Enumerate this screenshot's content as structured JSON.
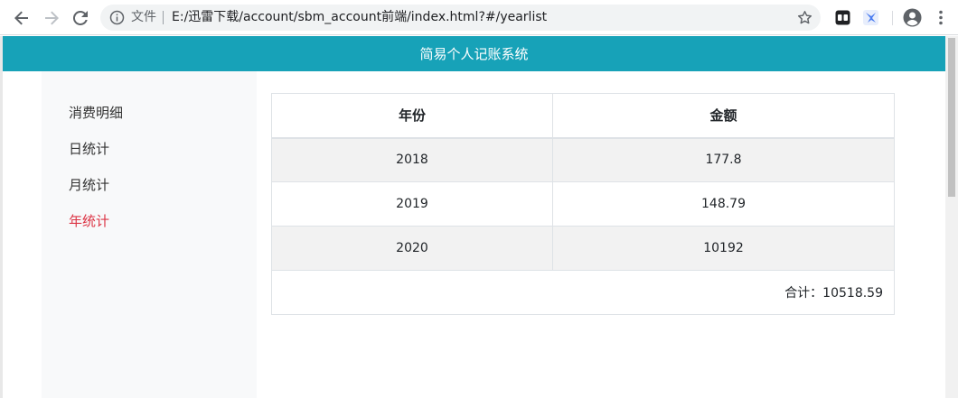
{
  "browser": {
    "file_label": "文件",
    "url": "E:/迅雷下载/account/sbm_account前端/index.html?#/yearlist"
  },
  "app": {
    "title": "简易个人记账系统"
  },
  "sidebar": {
    "items": [
      {
        "label": "消费明细",
        "active": false
      },
      {
        "label": "日统计",
        "active": false
      },
      {
        "label": "月统计",
        "active": false
      },
      {
        "label": "年统计",
        "active": true
      }
    ]
  },
  "table": {
    "headers": {
      "year": "年份",
      "amount": "金额"
    },
    "rows": [
      {
        "year": "2018",
        "amount": "177.8"
      },
      {
        "year": "2019",
        "amount": "148.79"
      },
      {
        "year": "2020",
        "amount": "10192"
      }
    ],
    "total_label": "合计：10518.59"
  },
  "colors": {
    "header_bg": "#17a2b8",
    "active_item": "#dc3545",
    "sidebar_bg": "#f8f9fa",
    "stripe_bg": "#f2f2f2"
  }
}
